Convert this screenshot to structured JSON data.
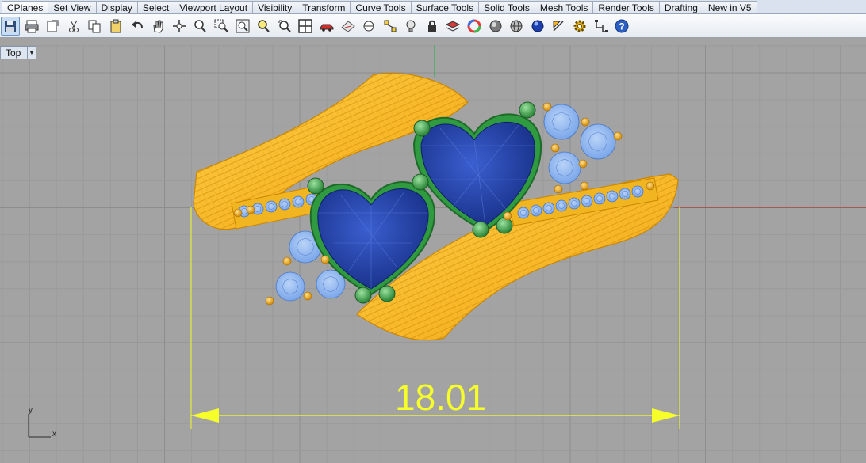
{
  "tabs": [
    "CPlanes",
    "Set View",
    "Display",
    "Select",
    "Viewport Layout",
    "Visibility",
    "Transform",
    "Curve Tools",
    "Surface Tools",
    "Solid Tools",
    "Mesh Tools",
    "Render Tools",
    "Drafting",
    "New in V5"
  ],
  "toolbar": {
    "icons": [
      "save-icon",
      "print-icon",
      "export-icon",
      "cut-icon",
      "copy-icon",
      "paste-icon",
      "undo-icon",
      "pan-hand-icon",
      "rotate-view-icon",
      "zoom-in-icon",
      "zoom-window-icon",
      "zoom-extents-icon",
      "zoom-selected-icon",
      "zoom-dynamic-icon",
      "four-viewports-icon",
      "car-icon",
      "properties-icon",
      "osnap-icon",
      "points-icon",
      "light-icon",
      "lock-icon",
      "layer-icon",
      "color-wheel-icon",
      "shaded-sphere-icon",
      "wireframe-sphere-icon",
      "rendered-sphere-icon",
      "dimension-icon",
      "settings-gear-icon",
      "align-icon",
      "help-icon"
    ]
  },
  "viewport": {
    "name": "Top",
    "dimension_value": "18.01",
    "axis_y": "y",
    "axis_x": "x"
  },
  "colors": {
    "background": "#a3a3a3",
    "grid_minor": "#999999",
    "grid_major": "#8c8c8c",
    "metal": "#f5b31e",
    "sapphire": "#1e3a9e",
    "diamond": "#8ab4ef",
    "prong": "#3fa84a",
    "dimension": "#f6ff2a"
  }
}
